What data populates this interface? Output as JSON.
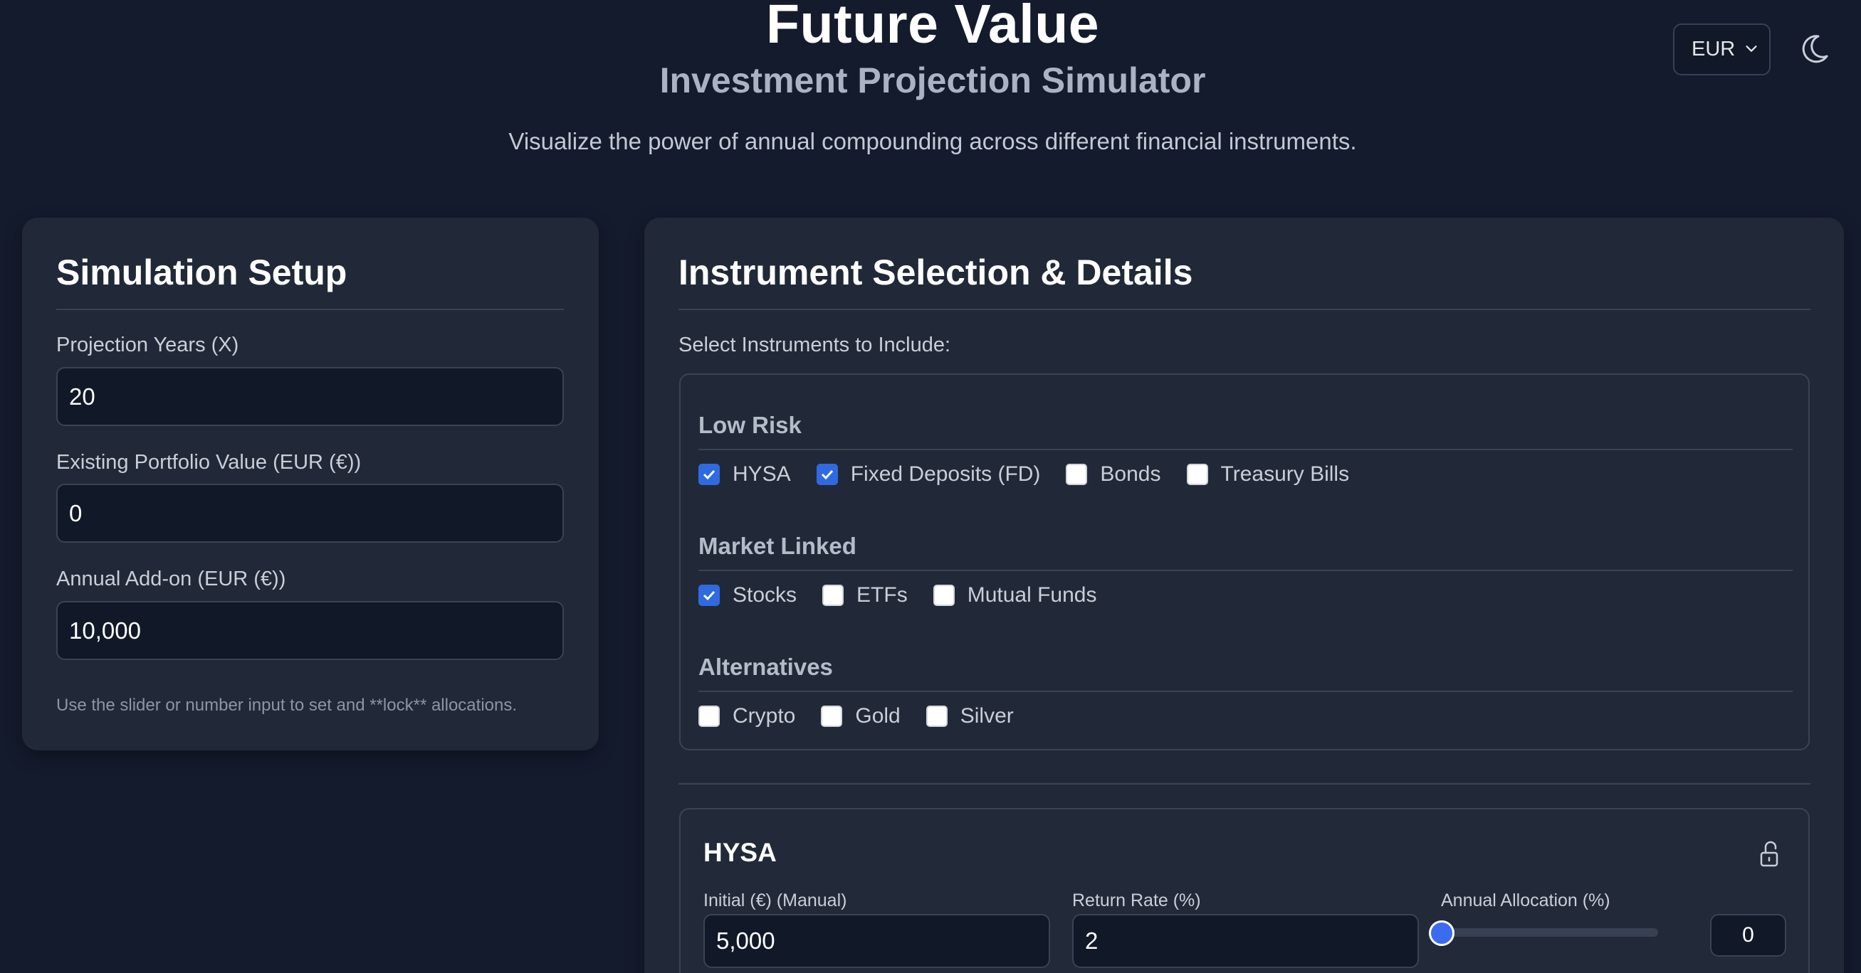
{
  "header": {
    "title": "Future Value",
    "subtitle": "Investment Projection Simulator",
    "tagline": "Visualize the power of annual compounding across different financial instruments.",
    "currency": "EUR",
    "theme_icon": "moon-icon"
  },
  "setup": {
    "title": "Simulation Setup",
    "years_label": "Projection Years (X)",
    "years_value": "20",
    "portfolio_label": "Existing Portfolio Value (EUR (€))",
    "portfolio_value": "0",
    "addon_label": "Annual Add-on (EUR (€))",
    "addon_value": "10,000",
    "hint": "Use the slider or number input to set and **lock** allocations."
  },
  "instruments": {
    "title": "Instrument Selection & Details",
    "select_label": "Select Instruments to Include:",
    "groups": [
      {
        "name": "Low Risk",
        "items": [
          {
            "label": "HYSA",
            "checked": true
          },
          {
            "label": "Fixed Deposits (FD)",
            "checked": true
          },
          {
            "label": "Bonds",
            "checked": false
          },
          {
            "label": "Treasury Bills",
            "checked": false
          }
        ]
      },
      {
        "name": "Market Linked",
        "items": [
          {
            "label": "Stocks",
            "checked": true
          },
          {
            "label": "ETFs",
            "checked": false
          },
          {
            "label": "Mutual Funds",
            "checked": false
          }
        ]
      },
      {
        "name": "Alternatives",
        "items": [
          {
            "label": "Crypto",
            "checked": false
          },
          {
            "label": "Gold",
            "checked": false
          },
          {
            "label": "Silver",
            "checked": false
          }
        ]
      }
    ]
  },
  "detail": {
    "name": "HYSA",
    "initial_label": "Initial (€) (Manual)",
    "initial_value": "5,000",
    "rate_label": "Return Rate (%)",
    "rate_value": "2",
    "allocation_label": "Annual Allocation (%)",
    "allocation_value": "0",
    "allocation_fraction": 0,
    "lock_icon": "unlock-icon"
  },
  "colors": {
    "background": "#141b2d",
    "card": "#212938",
    "accent": "#2f6ae0"
  }
}
